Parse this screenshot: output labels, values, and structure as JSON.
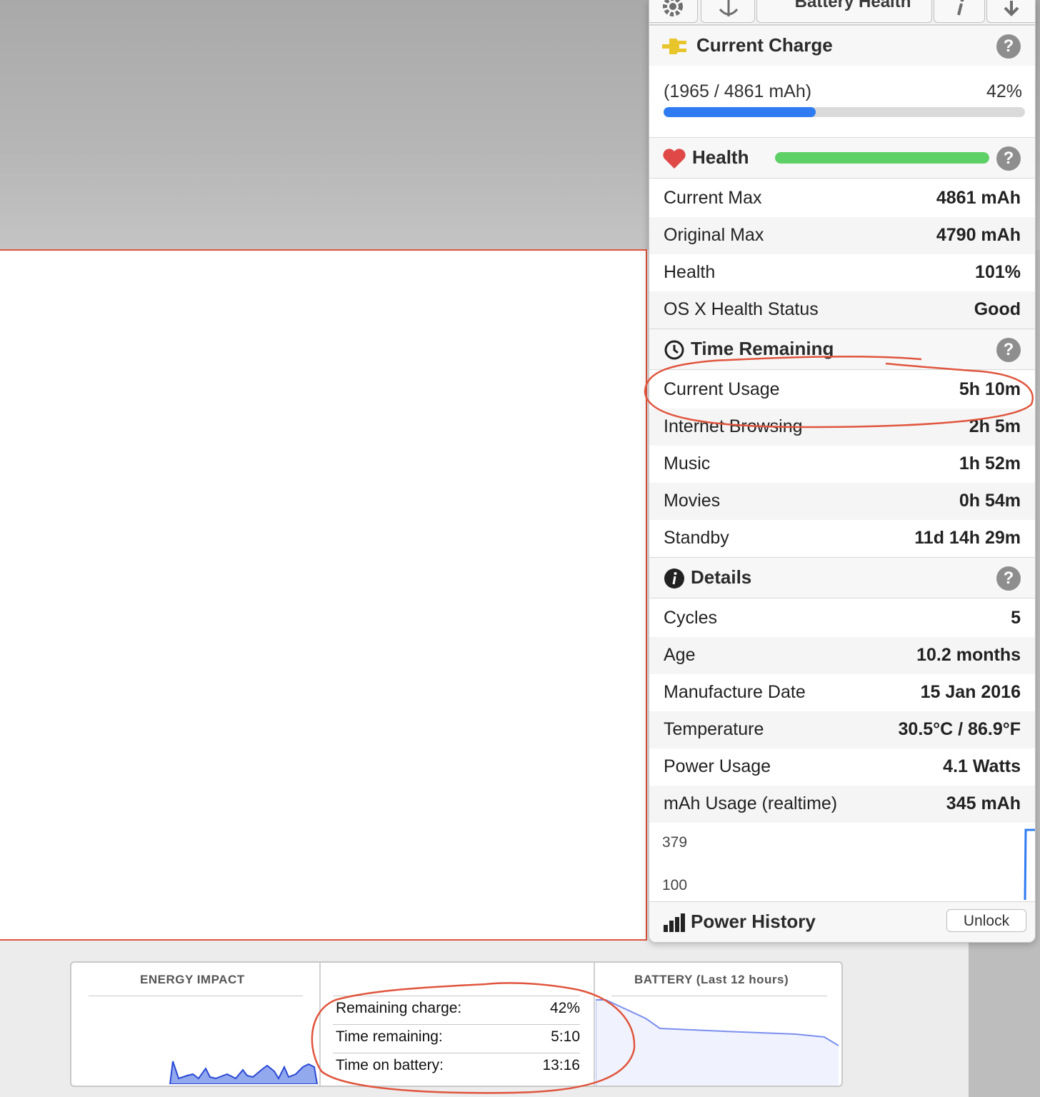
{
  "colors": {
    "charge_bar": "#2f7bf2",
    "health_bar": "#5dd166",
    "annotation": "#e0553d",
    "heart": "#e04848",
    "plug": "#e8c52a"
  },
  "toolbar": {
    "title": "Battery Health",
    "icons": [
      "gear-icon",
      "anchor-icon",
      "info-icon",
      "download-icon"
    ]
  },
  "current_charge": {
    "title": "Current Charge",
    "mah": "(1965 / 4861 mAh)",
    "percent": "42%",
    "fill_fraction": 0.42
  },
  "health": {
    "title": "Health",
    "fill_fraction": 1.0,
    "rows": [
      {
        "label": "Current Max",
        "value": "4861 mAh"
      },
      {
        "label": "Original Max",
        "value": "4790 mAh"
      },
      {
        "label": "Health",
        "value": "101%"
      },
      {
        "label": "OS X Health Status",
        "value": "Good"
      }
    ]
  },
  "time_remaining": {
    "title": "Time Remaining",
    "rows": [
      {
        "label": "Current Usage",
        "value": "5h 10m"
      },
      {
        "label": "Internet Browsing",
        "value": "2h 5m"
      },
      {
        "label": "Music",
        "value": "1h 52m"
      },
      {
        "label": "Movies",
        "value": "0h 54m"
      },
      {
        "label": "Standby",
        "value": "11d 14h 29m"
      }
    ]
  },
  "details": {
    "title": "Details",
    "rows": [
      {
        "label": "Cycles",
        "value": "5"
      },
      {
        "label": "Age",
        "value": "10.2 months"
      },
      {
        "label": "Manufacture Date",
        "value": "15 Jan 2016"
      },
      {
        "label": "Temperature",
        "value": "30.5°C / 86.9°F"
      },
      {
        "label": "Power Usage",
        "value": "4.1 Watts"
      },
      {
        "label": "mAh Usage (realtime)",
        "value": "345 mAh"
      }
    ]
  },
  "graph": {
    "top_label": "379",
    "bottom_label": "100"
  },
  "power_history": {
    "title": "Power History",
    "unlock_label": "Unlock"
  },
  "activity": {
    "energy_title": "ENERGY IMPACT",
    "battery_title": "BATTERY (Last 12 hours)",
    "rows": [
      {
        "label": "Remaining charge:",
        "value": "42%"
      },
      {
        "label": "Time remaining:",
        "value": "5:10"
      },
      {
        "label": "Time on battery:",
        "value": "13:16"
      }
    ]
  }
}
